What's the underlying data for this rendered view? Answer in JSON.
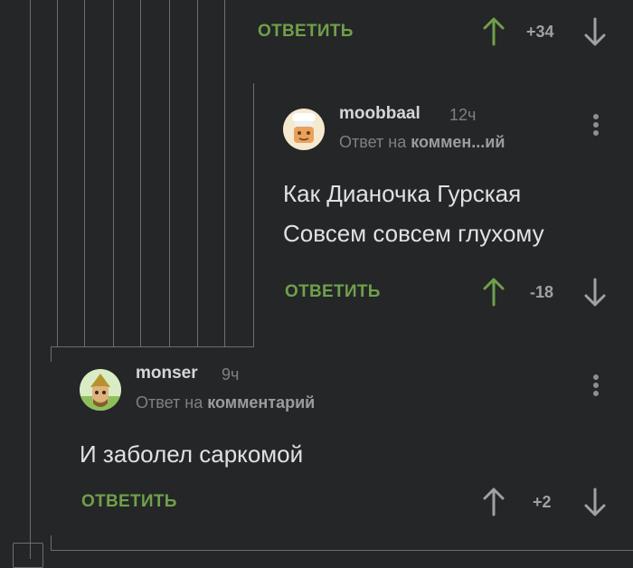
{
  "top_comment": {
    "reply_label": "ОТВЕТИТЬ",
    "score": "+34",
    "upvote_color": "#6fa04b",
    "downvote_color": "#9fa1a3"
  },
  "comment_moobbaal": {
    "author": "moobbaal",
    "time": "12ч",
    "reply_to_prefix": "Ответ на",
    "reply_to_target": "коммен...ий",
    "text_lines": [
      "Как Дианочка Гурская",
      "Совсем совсем глухому"
    ],
    "reply_label": "ОТВЕТИТЬ",
    "score": "-18",
    "upvote_color": "#6fa04b",
    "downvote_color": "#9fa1a3"
  },
  "comment_monser": {
    "author": "monser",
    "time": "9ч",
    "reply_to_prefix": "Ответ на",
    "reply_to_target": "комментарий",
    "text": "И заболел саркомой",
    "reply_label": "ОТВЕТИТЬ",
    "score": "+2",
    "upvote_color": "#9fa1a3",
    "downvote_color": "#9fa1a3"
  },
  "theme": {
    "background": "#252627",
    "accent_green": "#6fa04b",
    "thread_line": "#6b6d6f"
  }
}
